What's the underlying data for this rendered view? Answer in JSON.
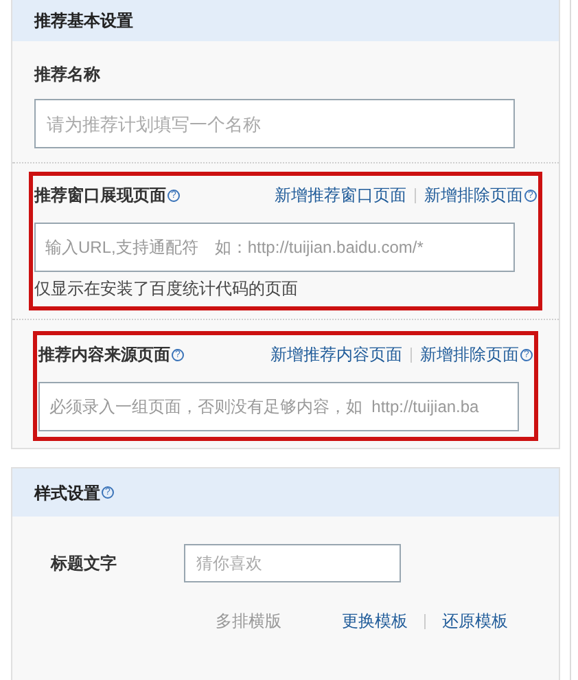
{
  "basic_settings": {
    "title": "推荐基本设置",
    "name_field": {
      "label": "推荐名称",
      "placeholder": "请为推荐计划填写一个名称"
    },
    "sections": [
      {
        "label": "推荐窗口展现页面",
        "help": "?",
        "links": [
          "新增推荐窗口页面",
          "新增排除页面"
        ],
        "links_help": "?",
        "placeholder": "输入URL,支持通配符　如：http://tuijian.baidu.com/*",
        "note": "仅显示在安装了百度统计代码的页面",
        "highlighted": true
      },
      {
        "label": "推荐内容来源页面",
        "help": "?",
        "links": [
          "新增推荐内容页面",
          "新增排除页面"
        ],
        "links_help": "?",
        "placeholder": "必须录入一组页面，否则没有足够内容，如  http://tuijian.ba",
        "highlighted": true
      }
    ]
  },
  "style_settings": {
    "title": "样式设置",
    "help": "?",
    "title_text": {
      "label": "标题文字",
      "placeholder": "猜你喜欢"
    },
    "layout": {
      "value": "多排横版",
      "links": [
        "更换模板",
        "还原模板"
      ]
    }
  }
}
